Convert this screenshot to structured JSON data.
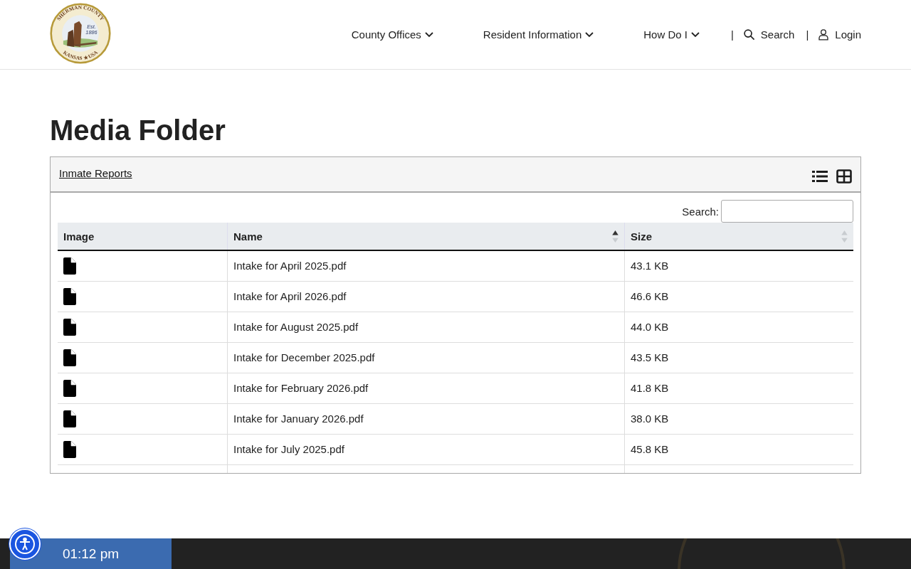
{
  "logo": {
    "top_text": "SHERMAN COUNTY",
    "bottom_text": "KANSAS ★ USA",
    "est": "Est.",
    "year": "1886"
  },
  "nav": {
    "items": [
      {
        "label": "County Offices",
        "kind": "dropdown"
      },
      {
        "label": "Resident Information",
        "kind": "dropdown"
      },
      {
        "label": "How Do I",
        "kind": "dropdown"
      },
      {
        "label": "Search",
        "kind": "search"
      },
      {
        "label": "Login",
        "kind": "login"
      }
    ],
    "separator": "|"
  },
  "title": "Media Folder",
  "folder": {
    "breadcrumb": "Inmate Reports",
    "views": [
      {
        "kind": "list"
      },
      {
        "kind": "grid"
      }
    ]
  },
  "search": {
    "label": "Search:"
  },
  "table": {
    "columns": [
      {
        "label": "Image",
        "sortable": false
      },
      {
        "label": "Name",
        "sortable": true,
        "sorted_ascending": true
      },
      {
        "label": "Size",
        "sortable": true,
        "sorted_ascending": false
      }
    ],
    "rows": [
      {
        "name": "Intake for April 2025.pdf",
        "size": "43.1 KB"
      },
      {
        "name": "Intake for April 2026.pdf",
        "size": "46.6 KB"
      },
      {
        "name": "Intake for August 2025.pdf",
        "size": "44.0 KB"
      },
      {
        "name": "Intake for December 2025.pdf",
        "size": "43.5 KB"
      },
      {
        "name": "Intake for February 2026.pdf",
        "size": "41.8 KB"
      },
      {
        "name": "Intake for January 2026.pdf",
        "size": "38.0 KB"
      },
      {
        "name": "Intake for July 2025.pdf",
        "size": "45.8 KB"
      }
    ]
  },
  "footer": {
    "time": "01:12 pm"
  }
}
